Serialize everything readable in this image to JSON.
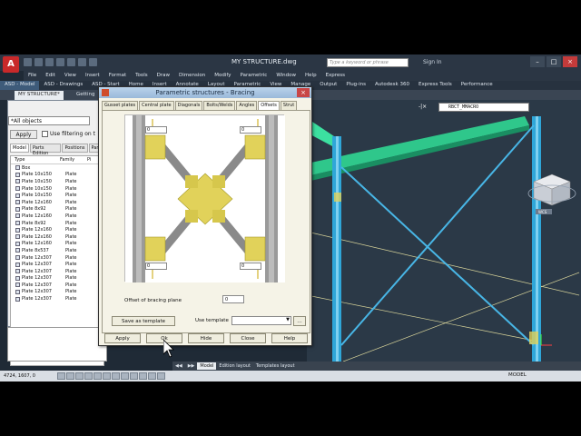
{
  "app": {
    "logo": "A",
    "title": "MY STRUCTURE.dwg",
    "search_placeholder": "Type a keyword or phrase",
    "sign_in": "Sign In"
  },
  "menu": [
    "File",
    "Edit",
    "View",
    "Insert",
    "Format",
    "Tools",
    "Draw",
    "Dimension",
    "Modify",
    "Parametric",
    "Window",
    "Help",
    "Express"
  ],
  "ribbon_tabs": [
    "ASD - Model",
    "ASD - Drawings",
    "ASD - Start",
    "Home",
    "Insert",
    "Annotate",
    "Layout",
    "Parametric",
    "View",
    "Manage",
    "Output",
    "Plug-ins",
    "Autodesk 360",
    "Express Tools",
    "Performance"
  ],
  "doc_tabs": [
    "MY STRUCTURE*",
    "Getting"
  ],
  "left_panel": {
    "selection": "*All objects",
    "apply": "Apply",
    "filter_label": "Use filtering on t",
    "tabs": [
      "Model",
      "Parts Edition",
      "Positions",
      "Parts"
    ],
    "columns": [
      "Type",
      "Family",
      "Pi"
    ],
    "rows": [
      {
        "type": "Box",
        "family": ""
      },
      {
        "type": "Plate 10x150",
        "family": "Plate"
      },
      {
        "type": "Plate 10x150",
        "family": "Plate"
      },
      {
        "type": "Plate 10x150",
        "family": "Plate"
      },
      {
        "type": "Plate 10x150",
        "family": "Plate"
      },
      {
        "type": "Plate 12x160",
        "family": "Plate"
      },
      {
        "type": "Plate 8x92",
        "family": "Plate"
      },
      {
        "type": "Plate 12x160",
        "family": "Plate"
      },
      {
        "type": "Plate 8x92",
        "family": "Plate"
      },
      {
        "type": "Plate 12x160",
        "family": "Plate"
      },
      {
        "type": "Plate 12x160",
        "family": "Plate"
      },
      {
        "type": "Plate 12x160",
        "family": "Plate"
      },
      {
        "type": "Plate 8x537",
        "family": "Plate"
      },
      {
        "type": "Plate 12x307",
        "family": "Plate"
      },
      {
        "type": "Plate 12x307",
        "family": "Plate"
      },
      {
        "type": "Plate 12x307",
        "family": "Plate"
      },
      {
        "type": "Plate 12x307",
        "family": "Plate"
      },
      {
        "type": "Plate 12x307",
        "family": "Plate"
      },
      {
        "type": "Plate 12x307",
        "family": "Plate"
      },
      {
        "type": "Plate 12x307",
        "family": "Plate"
      }
    ]
  },
  "viewport": {
    "view_name": "RBCT_MMACRO",
    "close_glyph": "-|×",
    "cube_label": "WCS"
  },
  "dialog": {
    "title": "Parametric structures - Bracing",
    "tabs": [
      "Gusset plates",
      "Central plate",
      "Diagonals",
      "Bolts/Welds",
      "Angles",
      "Offsets",
      "Strut"
    ],
    "active_tab": "Offsets",
    "offset_top_left": "0",
    "offset_top_right": "0",
    "offset_bottom_left": "0",
    "offset_bottom_right": "0",
    "offset_plane_label": "Offset of bracing plane",
    "offset_plane_value": "0",
    "save_template": "Save as template",
    "use_template": "Use template",
    "buttons": {
      "apply": "Apply",
      "ok": "Ok",
      "hide": "Hide",
      "close": "Close",
      "help": "Help"
    }
  },
  "layout_tabs": [
    "Model",
    "Edition layout",
    "Templates layout"
  ],
  "status": {
    "coords": "4724, 1607, 0",
    "model": "MODEL"
  },
  "colors": {
    "steel_column": "#2fa6d8",
    "steel_beam": "#39d29a",
    "plate": "#e1d25a",
    "viewport_bg": "#2b3947",
    "dialog_bg": "#f5f3e7",
    "title_bar": "#2b3644"
  }
}
